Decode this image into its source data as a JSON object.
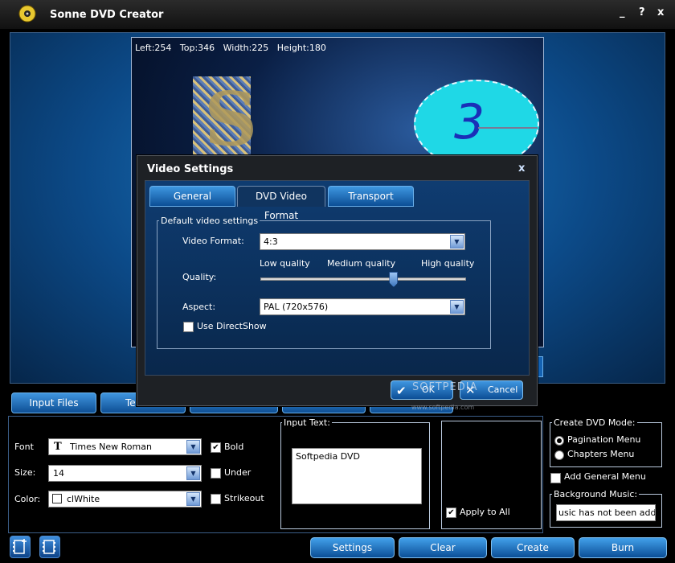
{
  "app": {
    "title": "Sonne DVD Creator",
    "help": "?",
    "minimize": "_",
    "close": "x"
  },
  "canvas": {
    "coords": "Left:254   Top:346   Width:225   Height:180",
    "clock_number": "3",
    "tile_letter": "S"
  },
  "tabs": {
    "input_files": "Input Files",
    "template": "Ten"
  },
  "props": {
    "font_label": "Font",
    "font_value": "Times New Roman",
    "size_label": "Size:",
    "size_value": "14",
    "color_label": "Color:",
    "color_value": "clWhite",
    "bold": "Bold",
    "underline": "Under",
    "strikeout": "Strikeout",
    "input_text_label": "Input Text:",
    "input_text_value": "Softpedia DVD",
    "apply_to_all": "Apply to All"
  },
  "dvd_mode": {
    "title": "Create DVD Mode:",
    "pagination": "Pagination Menu",
    "chapters": "Chapters Menu",
    "add_general_menu": "Add General Menu"
  },
  "music": {
    "title": "Background Music:",
    "value": "usic has not been added"
  },
  "bottom": {
    "settings": "Settings",
    "clear": "Clear",
    "create": "Create",
    "burn": "Burn"
  },
  "dialog": {
    "title": "Video Settings",
    "close": "x",
    "tabs": [
      "General",
      "DVD Video Format",
      "Transport"
    ],
    "group": "Default video settings",
    "video_format_label": "Video Format:",
    "video_format_value": "4:3",
    "quality_label": "Quality:",
    "quality_low": "Low quality",
    "quality_medium": "Medium quality",
    "quality_high": "High quality",
    "quality_position": 0.65,
    "aspect_label": "Aspect:",
    "aspect_value": "PAL (720x576)",
    "use_directshow": "Use DirectShow",
    "ok": "OK",
    "cancel": "Cancel"
  },
  "watermark": {
    "main": "SOFTPEDIA",
    "sub": "www.softpedia.com"
  }
}
